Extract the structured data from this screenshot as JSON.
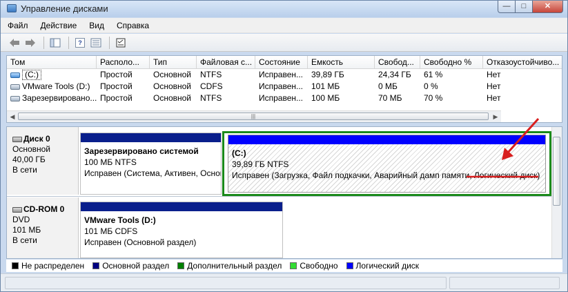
{
  "window": {
    "title": "Управление дисками",
    "min_label": "—",
    "max_label": "□",
    "close_label": "✕"
  },
  "menu": [
    "Файл",
    "Действие",
    "Вид",
    "Справка"
  ],
  "toolbar": {
    "back_icon": "back-arrow-icon",
    "forward_icon": "forward-arrow-icon",
    "help_label": "?"
  },
  "volumes": {
    "headers": [
      "Том",
      "Располо...",
      "Тип",
      "Файловая с...",
      "Состояние",
      "Емкость",
      "Свобод...",
      "Свободно %",
      "Отказоустойчиво..."
    ],
    "rows": [
      [
        "(C:)",
        "Простой",
        "Основной",
        "NTFS",
        "Исправен...",
        "39,89 ГБ",
        "24,34 ГБ",
        "61 %",
        "Нет"
      ],
      [
        "VMware Tools (D:)",
        "Простой",
        "Основной",
        "CDFS",
        "Исправен...",
        "101 МБ",
        "0 МБ",
        "0 %",
        "Нет"
      ],
      [
        "Зарезервировано...",
        "Простой",
        "Основной",
        "NTFS",
        "Исправен...",
        "100 МБ",
        "70 МБ",
        "70 %",
        "Нет"
      ]
    ]
  },
  "disks": [
    {
      "name": "Диск 0",
      "type": "Основной",
      "size": "40,00 ГБ",
      "status": "В сети",
      "partitions": [
        {
          "name": "Зарезервировано системой",
          "size_fs": "100 МБ NTFS",
          "status": "Исправен (Система, Активен, Основной раздел)"
        },
        {
          "name": "(C:)",
          "size_fs": "39,89 ГБ NTFS",
          "status": "Исправен (Загрузка, Файл подкачки, Аварийный дамп памяти, Логический диск)"
        }
      ]
    },
    {
      "name": "CD-ROM 0",
      "type": "DVD",
      "size": "101 МБ",
      "status": "В сети",
      "partitions": [
        {
          "name": "VMware Tools (D:)",
          "size_fs": "101 МБ CDFS",
          "status": "Исправен (Основной раздел)"
        }
      ]
    }
  ],
  "legend": [
    {
      "label": "Не распределен",
      "color": "#000000"
    },
    {
      "label": "Основной раздел",
      "color": "#000080"
    },
    {
      "label": "Дополнительный раздел",
      "color": "#008000"
    },
    {
      "label": "Свободно",
      "color": "#33dd33"
    },
    {
      "label": "Логический диск",
      "color": "#0000ff"
    }
  ],
  "colors": {
    "primary_bar": "#0a1f8c",
    "logical_bar": "#0000ff",
    "extended_border": "#1a8a1a",
    "annotation": "#d81e1e"
  }
}
